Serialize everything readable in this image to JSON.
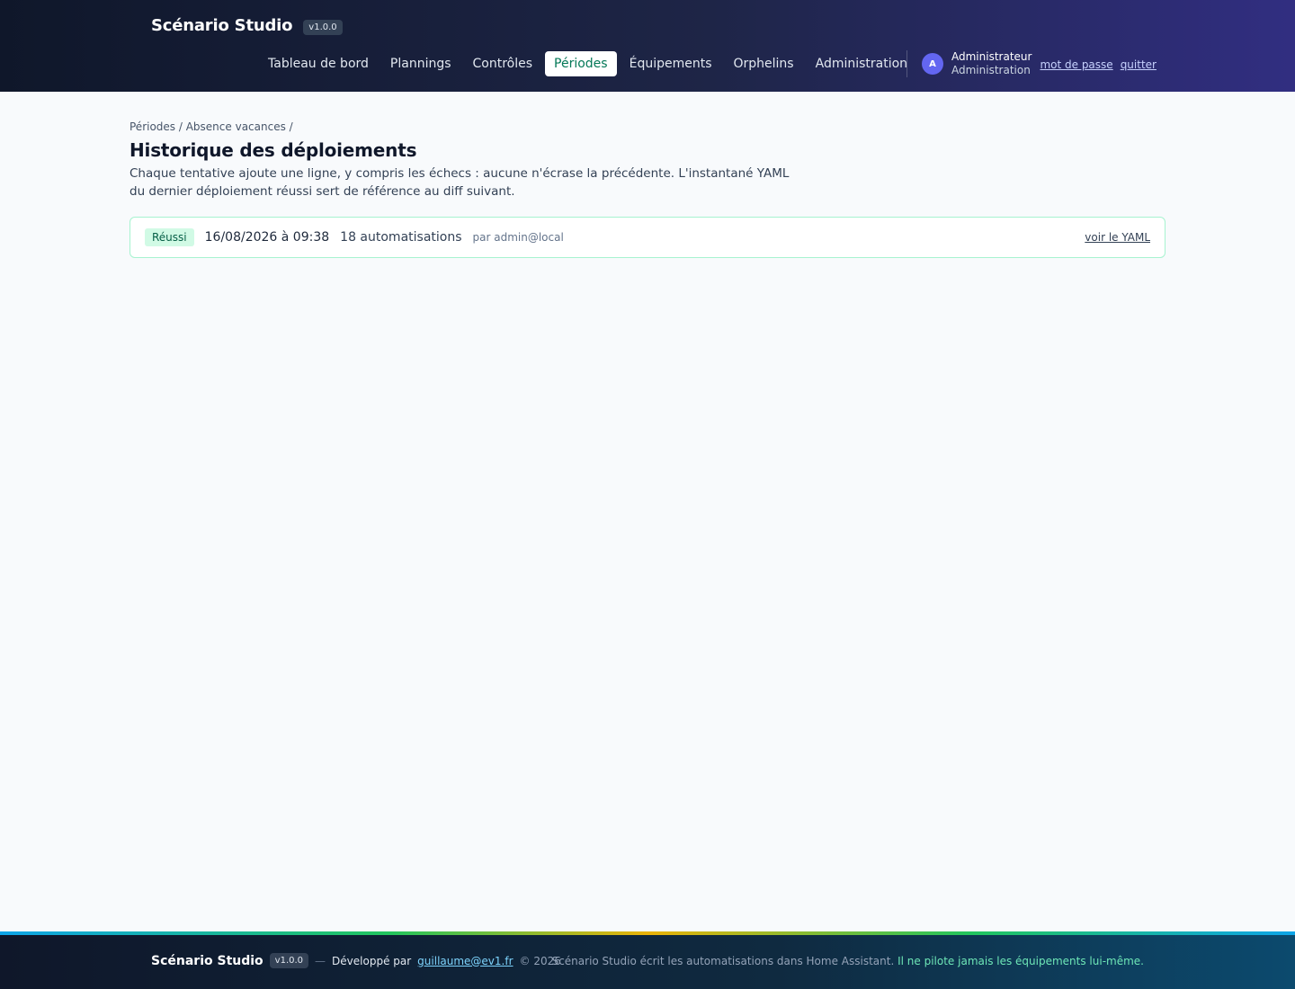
{
  "header": {
    "brand": "Scénario Studio",
    "version": "v1.0.0",
    "nav": [
      {
        "label": "Tableau de bord",
        "active": false
      },
      {
        "label": "Plannings",
        "active": false
      },
      {
        "label": "Contrôles",
        "active": false
      },
      {
        "label": "Périodes",
        "active": true
      },
      {
        "label": "Équipements",
        "active": false
      },
      {
        "label": "Orphelins",
        "active": false
      },
      {
        "label": "Administration",
        "active": false
      }
    ],
    "user": {
      "initial": "A",
      "name": "Administrateur",
      "role": "Administration",
      "password_link": "mot de passe",
      "logout_link": "quitter"
    }
  },
  "main": {
    "breadcrumb": "Périodes / Absence vacances /",
    "title": "Historique des déploiements",
    "description": "Chaque tentative ajoute une ligne, y compris les échecs : aucune n'écrase la précédente. L'instantané YAML du dernier déploiement réussi sert de référence au diff suivant.",
    "deployments": [
      {
        "status": "Réussi",
        "date": "16/08/2026 à 09:38",
        "count": "18 automatisations",
        "author": "par admin@local",
        "link": "voir le YAML"
      }
    ]
  },
  "footer": {
    "brand": "Scénario Studio",
    "version": "v1.0.0",
    "dash": "—",
    "developed_by": "Développé par",
    "email": "guillaume@ev1.fr",
    "copyright": "© 2026",
    "note": "Scénario Studio écrit les automatisations dans Home Assistant.",
    "note_accent": "Il ne pilote jamais les équipements lui-même."
  },
  "colors": {
    "accent": "#047857",
    "success_bg": "#d1fae5",
    "success_border": "#a7f3d0",
    "avatar": "#6366f1"
  }
}
